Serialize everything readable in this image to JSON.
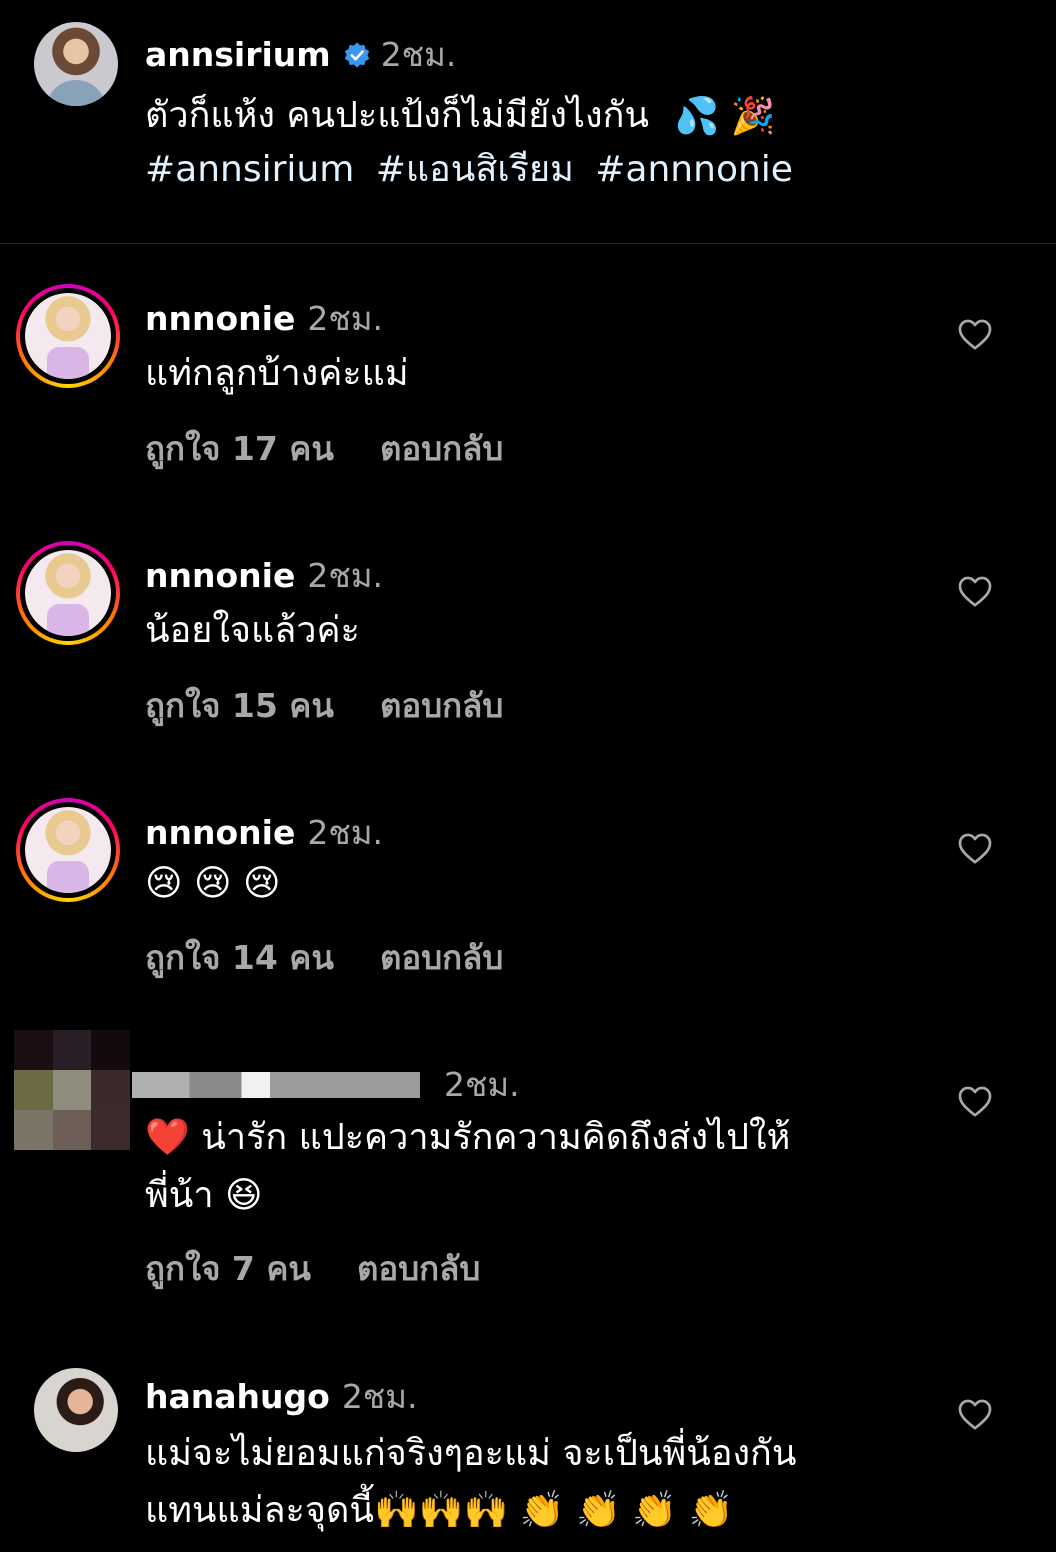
{
  "post": {
    "author": "annsirium",
    "time": "2ชม.",
    "caption": "ตัวก็แห้ง คนปะแป้งก็ไม่มียังไงกัน",
    "caption_emojis": [
      "💦",
      "🎉"
    ],
    "hashtags": [
      "#annsirium",
      "#แอนสิเรียม",
      "#annnonie"
    ]
  },
  "comments": [
    {
      "username": "nnnonie",
      "time": "2ชม.",
      "text": "แท่กลูกบ้างค่ะแม่",
      "likes": "ถูกใจ 17 คน",
      "reply": "ตอบกลับ",
      "icon": "heart-outline-icon"
    },
    {
      "username": "nnnonie",
      "time": "2ชม.",
      "text": "น้อยใจแล้วค่ะ",
      "likes": "ถูกใจ 15 คน",
      "reply": "ตอบกลับ",
      "icon": "heart-outline-icon"
    },
    {
      "username": "nnnonie",
      "time": "2ชม.",
      "text": "😢 😢 😢",
      "likes": "ถูกใจ 14 คน",
      "reply": "ตอบกลับ",
      "icon": "heart-outline-icon"
    },
    {
      "username": "",
      "time": "2ชม.",
      "text_line1": "❤️ น่ารัก แปะความรักความคิดถึงส่งไปให้",
      "text_line2": "พี่น้า 😆",
      "likes": "ถูกใจ 7 คน",
      "reply": "ตอบกลับ",
      "icon": "heart-outline-icon"
    },
    {
      "username": "hanahugo",
      "time": "2ชม.",
      "text_line1": "แม่จะไม่ยอมแก่จริงๆอะแม่ จะเป็นพี่น้องกัน",
      "text_line2": "แทนแม่ละจุดนี้🙌🙌🙌 👏 👏 👏 👏",
      "icon": "heart-outline-icon"
    }
  ],
  "colors": {
    "background": "#000000",
    "text": "#ffffff",
    "secondary": "#a8a8a8",
    "hashtag": "#e0f1ff",
    "verified": "#3897f0"
  }
}
